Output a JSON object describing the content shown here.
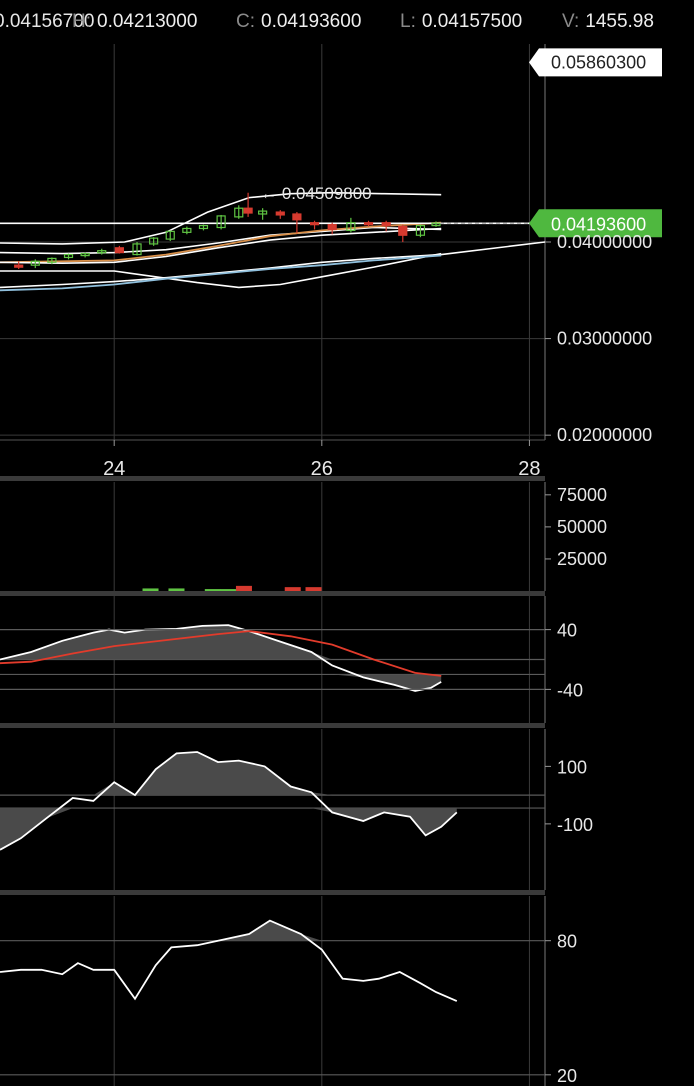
{
  "header": {
    "open_value": "0.04156700",
    "high_label": "H:",
    "high_value": "0.04213000",
    "close_label": "C:",
    "close_value": "0.04193600",
    "low_label": "L:",
    "low_value": "0.04157500",
    "volume_label": "V:",
    "volume_value": "1455.98"
  },
  "colors": {
    "up": "#5fc443",
    "down": "#d63a2f",
    "current_price": "#4fb83f",
    "grid": "#3a3a3a",
    "ma_orange": "#d9904a",
    "ma_blue": "#8fbfdc",
    "rsi_signal": "#e23b2b"
  },
  "chart_data": [
    {
      "type": "candlestick",
      "panel": "price",
      "x_axis": {
        "ticks": [
          "24",
          "26",
          "28"
        ],
        "range": [
          22.9,
          28.15
        ]
      },
      "y_axis": {
        "ticks": [
          "0.03000000",
          "0.02000000",
          "0.04000000"
        ],
        "range": [
          0.0195,
          0.0605
        ]
      },
      "labels": {
        "high_marker": "0.04509800",
        "top_tag": "0.05860300",
        "current_tag": "0.04193600"
      },
      "markers": {
        "high_marker": {
          "x": 25.29,
          "y": 0.045098
        },
        "top_tag": {
          "y": 0.058603
        },
        "current_tag": {
          "y": 0.041936
        }
      },
      "candles": [
        {
          "x": 23.08,
          "o": 0.0376,
          "h": 0.038,
          "l": 0.0372,
          "c": 0.0374
        },
        {
          "x": 23.24,
          "o": 0.0376,
          "h": 0.0382,
          "l": 0.0373,
          "c": 0.038
        },
        {
          "x": 23.4,
          "o": 0.0379,
          "h": 0.0384,
          "l": 0.0377,
          "c": 0.0383
        },
        {
          "x": 23.56,
          "o": 0.0384,
          "h": 0.0388,
          "l": 0.0382,
          "c": 0.0387
        },
        {
          "x": 23.72,
          "o": 0.0386,
          "h": 0.0389,
          "l": 0.0384,
          "c": 0.0388
        },
        {
          "x": 23.88,
          "o": 0.0389,
          "h": 0.0393,
          "l": 0.0387,
          "c": 0.0391
        },
        {
          "x": 24.05,
          "o": 0.0394,
          "h": 0.0396,
          "l": 0.0388,
          "c": 0.0389
        },
        {
          "x": 24.22,
          "o": 0.0387,
          "h": 0.04,
          "l": 0.0386,
          "c": 0.0398
        },
        {
          "x": 24.38,
          "o": 0.0398,
          "h": 0.0405,
          "l": 0.0396,
          "c": 0.0404
        },
        {
          "x": 24.54,
          "o": 0.0403,
          "h": 0.0412,
          "l": 0.0401,
          "c": 0.0411
        },
        {
          "x": 24.7,
          "o": 0.041,
          "h": 0.0416,
          "l": 0.0408,
          "c": 0.0414
        },
        {
          "x": 24.86,
          "o": 0.0414,
          "h": 0.0418,
          "l": 0.0412,
          "c": 0.0417
        },
        {
          "x": 25.03,
          "o": 0.0415,
          "h": 0.0428,
          "l": 0.0413,
          "c": 0.0427
        },
        {
          "x": 25.2,
          "o": 0.0426,
          "h": 0.0438,
          "l": 0.0424,
          "c": 0.0435
        },
        {
          "x": 25.29,
          "o": 0.0435,
          "h": 0.0451,
          "l": 0.0426,
          "c": 0.043
        },
        {
          "x": 25.43,
          "o": 0.0429,
          "h": 0.0435,
          "l": 0.0423,
          "c": 0.0432
        },
        {
          "x": 25.6,
          "o": 0.0431,
          "h": 0.0433,
          "l": 0.0424,
          "c": 0.0428
        },
        {
          "x": 25.76,
          "o": 0.0429,
          "h": 0.0431,
          "l": 0.0409,
          "c": 0.0423
        },
        {
          "x": 25.93,
          "o": 0.042,
          "h": 0.0422,
          "l": 0.0413,
          "c": 0.0418
        },
        {
          "x": 26.1,
          "o": 0.0418,
          "h": 0.042,
          "l": 0.0408,
          "c": 0.0413
        },
        {
          "x": 26.28,
          "o": 0.0412,
          "h": 0.0425,
          "l": 0.041,
          "c": 0.042
        },
        {
          "x": 26.45,
          "o": 0.042,
          "h": 0.0422,
          "l": 0.0416,
          "c": 0.0418
        },
        {
          "x": 26.62,
          "o": 0.042,
          "h": 0.0422,
          "l": 0.0411,
          "c": 0.0417
        },
        {
          "x": 26.78,
          "o": 0.0416,
          "h": 0.0418,
          "l": 0.04,
          "c": 0.0407
        },
        {
          "x": 26.95,
          "o": 0.0407,
          "h": 0.0418,
          "l": 0.0405,
          "c": 0.0417
        },
        {
          "x": 27.1,
          "o": 0.0417,
          "h": 0.04213,
          "l": 0.04157,
          "c": 0.04194
        }
      ],
      "lines": [
        {
          "color": "white",
          "points": [
            [
              22.9,
              0.0399
            ],
            [
              23.5,
              0.0398
            ],
            [
              24.1,
              0.04
            ],
            [
              24.5,
              0.041
            ],
            [
              24.9,
              0.0431
            ],
            [
              25.3,
              0.0446
            ],
            [
              25.7,
              0.045
            ],
            [
              26.1,
              0.0451
            ],
            [
              26.6,
              0.045
            ],
            [
              27.15,
              0.0449
            ]
          ]
        },
        {
          "color": "white",
          "points": [
            [
              22.9,
              0.0389
            ],
            [
              23.5,
              0.0388
            ],
            [
              24.0,
              0.0389
            ],
            [
              24.5,
              0.0392
            ],
            [
              25.0,
              0.0399
            ],
            [
              25.5,
              0.0407
            ],
            [
              26.0,
              0.0411
            ],
            [
              26.5,
              0.0415
            ],
            [
              27.15,
              0.0413
            ]
          ]
        },
        {
          "color": "orange",
          "points": [
            [
              22.9,
              0.0379
            ],
            [
              23.5,
              0.038
            ],
            [
              24.0,
              0.0381
            ],
            [
              24.5,
              0.0387
            ],
            [
              25.0,
              0.0396
            ],
            [
              25.5,
              0.0406
            ],
            [
              26.0,
              0.0412
            ],
            [
              26.5,
              0.0416
            ],
            [
              27.15,
              0.042
            ]
          ]
        },
        {
          "color": "white",
          "points": [
            [
              22.9,
              0.0379
            ],
            [
              23.5,
              0.0378
            ],
            [
              24.0,
              0.0379
            ],
            [
              24.5,
              0.0385
            ],
            [
              25.0,
              0.0394
            ],
            [
              25.5,
              0.0402
            ],
            [
              26.0,
              0.0407
            ],
            [
              26.5,
              0.041
            ],
            [
              27.15,
              0.0414
            ]
          ]
        },
        {
          "color": "white",
          "points": [
            [
              22.9,
              0.037
            ],
            [
              23.5,
              0.037
            ],
            [
              24.0,
              0.037
            ],
            [
              24.4,
              0.0364
            ],
            [
              24.8,
              0.0358
            ],
            [
              25.2,
              0.0353
            ],
            [
              25.6,
              0.0356
            ],
            [
              26.0,
              0.0364
            ],
            [
              26.5,
              0.0374
            ],
            [
              27.15,
              0.0388
            ]
          ]
        },
        {
          "color": "white",
          "points": [
            [
              22.9,
              0.0353
            ],
            [
              23.5,
              0.0356
            ],
            [
              24.0,
              0.0359
            ],
            [
              24.5,
              0.0363
            ],
            [
              25.0,
              0.0368
            ],
            [
              25.5,
              0.0373
            ],
            [
              26.0,
              0.0379
            ],
            [
              26.5,
              0.0383
            ],
            [
              27.15,
              0.0387
            ],
            [
              28.15,
              0.04
            ]
          ]
        },
        {
          "color": "blue",
          "points": [
            [
              22.9,
              0.035
            ],
            [
              23.5,
              0.0352
            ],
            [
              24.0,
              0.0356
            ],
            [
              24.5,
              0.0362
            ],
            [
              25.0,
              0.0367
            ],
            [
              25.5,
              0.0372
            ],
            [
              26.0,
              0.0376
            ],
            [
              26.5,
              0.0381
            ],
            [
              27.15,
              0.0386
            ]
          ]
        },
        {
          "color": "white",
          "points": [
            [
              22.9,
              0.04194
            ],
            [
              28.15,
              0.04194
            ]
          ]
        }
      ]
    },
    {
      "type": "bar",
      "panel": "volume",
      "y_axis": {
        "ticks": [
          "75000",
          "50000",
          "25000"
        ],
        "range": [
          0,
          85000
        ]
      },
      "bars": [
        {
          "x": 24.35,
          "v": 2000,
          "dir": "up"
        },
        {
          "x": 24.6,
          "v": 2000,
          "dir": "up"
        },
        {
          "x": 24.95,
          "v": 1500,
          "dir": "up"
        },
        {
          "x": 25.1,
          "v": 1500,
          "dir": "up"
        },
        {
          "x": 25.25,
          "v": 4000,
          "dir": "down"
        },
        {
          "x": 25.72,
          "v": 3000,
          "dir": "down"
        },
        {
          "x": 25.92,
          "v": 3000,
          "dir": "down"
        }
      ]
    },
    {
      "type": "line",
      "panel": "oscillator_1",
      "y_axis": {
        "ticks": [
          "40",
          "-40"
        ]
      },
      "zero_line": 0,
      "series": [
        {
          "color": "white",
          "points": [
            [
              22.9,
              0
            ],
            [
              23.2,
              10
            ],
            [
              23.5,
              25
            ],
            [
              23.8,
              36
            ],
            [
              23.95,
              40
            ],
            [
              24.1,
              36
            ],
            [
              24.3,
              40
            ],
            [
              24.6,
              41
            ],
            [
              24.85,
              45
            ],
            [
              25.1,
              46
            ],
            [
              25.3,
              38
            ],
            [
              25.6,
              24
            ],
            [
              25.9,
              10
            ],
            [
              26.1,
              -8
            ],
            [
              26.4,
              -24
            ],
            [
              26.7,
              -34
            ],
            [
              26.9,
              -42
            ],
            [
              27.05,
              -38
            ],
            [
              27.15,
              -30
            ]
          ]
        },
        {
          "color": "red",
          "points": [
            [
              22.9,
              -5
            ],
            [
              23.2,
              -3
            ],
            [
              23.6,
              8
            ],
            [
              24.0,
              18
            ],
            [
              24.5,
              26
            ],
            [
              25.0,
              34
            ],
            [
              25.3,
              38
            ],
            [
              25.7,
              31
            ],
            [
              26.1,
              20
            ],
            [
              26.5,
              0
            ],
            [
              26.9,
              -18
            ],
            [
              27.15,
              -22
            ]
          ]
        }
      ]
    },
    {
      "type": "line",
      "panel": "oscillator_2",
      "y_axis": {
        "ticks": [
          "100",
          "-100"
        ]
      },
      "zero_line": 0,
      "series": [
        {
          "color": "white",
          "points": [
            [
              22.9,
              -190
            ],
            [
              23.1,
              -150
            ],
            [
              23.35,
              -80
            ],
            [
              23.6,
              -10
            ],
            [
              23.8,
              -20
            ],
            [
              24.0,
              45
            ],
            [
              24.2,
              0
            ],
            [
              24.4,
              90
            ],
            [
              24.6,
              145
            ],
            [
              24.8,
              150
            ],
            [
              25.0,
              115
            ],
            [
              25.2,
              120
            ],
            [
              25.45,
              100
            ],
            [
              25.7,
              30
            ],
            [
              25.9,
              10
            ],
            [
              26.1,
              -60
            ],
            [
              26.4,
              -90
            ],
            [
              26.6,
              -60
            ],
            [
              26.85,
              -75
            ],
            [
              27.0,
              -140
            ],
            [
              27.15,
              -110
            ],
            [
              27.3,
              -60
            ]
          ]
        }
      ]
    },
    {
      "type": "line",
      "panel": "oscillator_3",
      "y_axis": {
        "ticks": [
          "80",
          "20"
        ]
      },
      "series": [
        {
          "color": "white",
          "points": [
            [
              22.9,
              66
            ],
            [
              23.1,
              67
            ],
            [
              23.3,
              67
            ],
            [
              23.5,
              65
            ],
            [
              23.65,
              70
            ],
            [
              23.8,
              67
            ],
            [
              24.0,
              67
            ],
            [
              24.2,
              54
            ],
            [
              24.4,
              69
            ],
            [
              24.55,
              77
            ],
            [
              24.8,
              78
            ],
            [
              25.0,
              80
            ],
            [
              25.3,
              83
            ],
            [
              25.5,
              89
            ],
            [
              25.8,
              83
            ],
            [
              26.0,
              76
            ],
            [
              26.2,
              63
            ],
            [
              26.4,
              62
            ],
            [
              26.55,
              63
            ],
            [
              26.75,
              66
            ],
            [
              26.95,
              61
            ],
            [
              27.1,
              57
            ],
            [
              27.3,
              53
            ]
          ]
        }
      ]
    }
  ]
}
